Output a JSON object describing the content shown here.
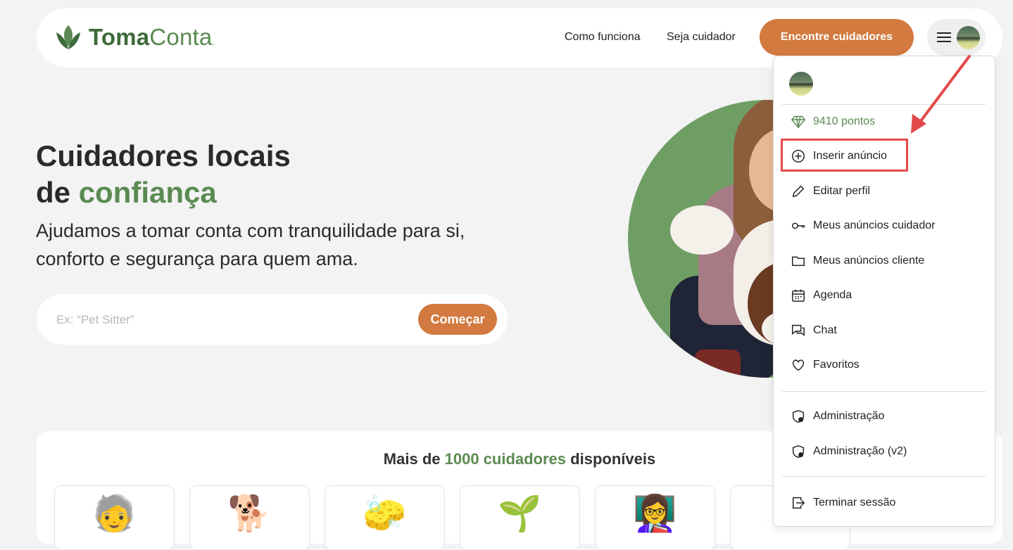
{
  "brand": {
    "name_part1": "Toma",
    "name_part2": "Conta",
    "name_part3": "."
  },
  "nav": {
    "links": [
      "Como funciona",
      "Seja cuidador"
    ],
    "cta_label": "Encontre cuidadores"
  },
  "hero": {
    "title_line1": "Cuidadores locais",
    "title_line2_prefix": "de ",
    "title_line2_accent": "confiança",
    "subtitle": "Ajudamos a tomar conta com tranquilidade para si, conforto e segurança para quem ama.",
    "search_placeholder": "Ex: “Pet Sitter”",
    "search_button": "Começar"
  },
  "availability": {
    "prefix": "Mais de ",
    "accent": "1000 cuidadores",
    "suffix": " disponíveis"
  },
  "categories": [
    {
      "icon": "elderly-care-icon",
      "glyph": "🧓"
    },
    {
      "icon": "pet-care-icon",
      "glyph": "🐕"
    },
    {
      "icon": "cleaning-icon",
      "glyph": "🧽"
    },
    {
      "icon": "gardening-icon",
      "glyph": "🌱"
    },
    {
      "icon": "tutoring-icon",
      "glyph": "👩‍🏫"
    },
    {
      "icon": "category-icon",
      "glyph": ""
    }
  ],
  "dropdown": {
    "points": "9410 pontos",
    "items": [
      {
        "label": "Inserir anúncio",
        "icon": "plus-circle-icon"
      },
      {
        "label": "Editar perfil",
        "icon": "pencil-icon"
      },
      {
        "label": "Meus anúncios cuidador",
        "icon": "key-icon"
      },
      {
        "label": "Meus anúncios cliente",
        "icon": "folder-icon"
      },
      {
        "label": "Agenda",
        "icon": "calendar-icon"
      },
      {
        "label": "Chat",
        "icon": "chat-icon"
      },
      {
        "label": "Favoritos",
        "icon": "heart-icon"
      }
    ],
    "admin_items": [
      {
        "label": "Administração",
        "icon": "shield-lock-icon"
      },
      {
        "label": "Administração (v2)",
        "icon": "shield-lock-icon"
      }
    ],
    "logout": {
      "label": "Terminar sessão",
      "icon": "logout-icon"
    }
  },
  "colors": {
    "brand_green": "#5b8a52",
    "accent_orange": "#d27a3f",
    "annotation_red": "#e24a4a"
  }
}
